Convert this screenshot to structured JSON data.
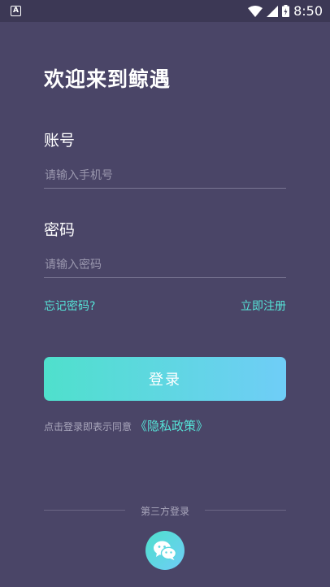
{
  "status_bar": {
    "time": "8:50",
    "notification_glyph": "A"
  },
  "login": {
    "title": "欢迎来到鲸遇",
    "account_label": "账号",
    "account_placeholder": "请输入手机号",
    "password_label": "密码",
    "password_placeholder": "请输入密码",
    "forgot_password": "忘记密码?",
    "register": "立即注册",
    "login_button": "登录",
    "agreement_text": "点击登录即表示同意",
    "privacy_policy": "《隐私政策》",
    "third_party_label": "第三方登录"
  },
  "colors": {
    "background": "#4a4567",
    "accent": "#55e3d7",
    "button_gradient_start": "#4fe0cc",
    "button_gradient_end": "#6fcdf7"
  },
  "icons": [
    "notification-icon",
    "wifi-icon",
    "signal-icon",
    "battery-icon",
    "wechat-icon"
  ]
}
